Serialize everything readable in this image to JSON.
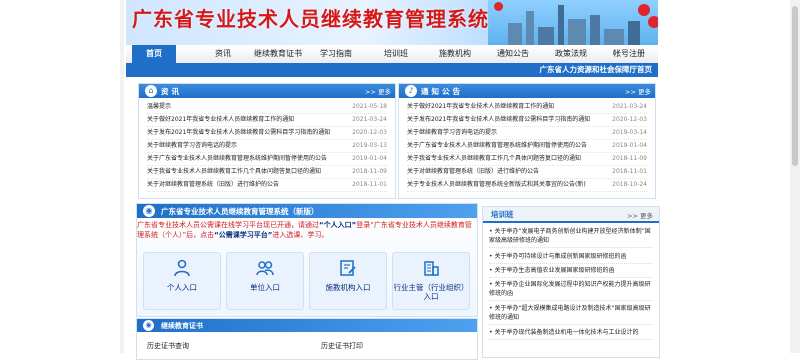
{
  "header": {
    "title": "广东省专业技术人员继续教育管理系统"
  },
  "nav": {
    "items": [
      {
        "label": "首页",
        "active": true
      },
      {
        "label": "资讯",
        "active": false
      },
      {
        "label": "继续教育证书",
        "active": false
      },
      {
        "label": "学习指南",
        "active": false
      },
      {
        "label": "培训班",
        "active": false
      },
      {
        "label": "施教机构",
        "active": false
      },
      {
        "label": "通知公告",
        "active": false
      },
      {
        "label": "政策法规",
        "active": false
      },
      {
        "label": "帐号注册",
        "active": false
      }
    ],
    "department": "广东省人力资源和社会保障厅首页"
  },
  "news_panel": {
    "title": "资讯",
    "more": "更多",
    "items": [
      {
        "title": "温馨提示",
        "date": "2021-05-18"
      },
      {
        "title": "关于做好2021年我省专业技术人员继续教育工作的通知",
        "date": "2021-03-24"
      },
      {
        "title": "关于发布2021年我省专业技术人员继续教育公需科目学习指南的通知",
        "date": "2020-12-03"
      },
      {
        "title": "关于继续教育学习咨询电话的提示",
        "date": "2019-03-13"
      },
      {
        "title": "关于广东省专业技术人员继续教育管理系统维护期间暂停使用的公告",
        "date": "2019-01-04"
      },
      {
        "title": "关于我省专业技术人员继续教育工作几个具体问题答复口径的通知",
        "date": "2018-11-09"
      },
      {
        "title": "关于对继续教育管理系统（旧版）进行维护的公告",
        "date": "2018-11-01"
      }
    ]
  },
  "notice_panel": {
    "title": "通知公告",
    "more": "更多",
    "items": [
      {
        "title": "关于做好2021年我省专业技术人员继续教育工作的通知",
        "date": "2021-03-24"
      },
      {
        "title": "关于发布2021年我省专业技术人员继续教育公需科目学习指南的通知",
        "date": "2020-12-03"
      },
      {
        "title": "关于继续教育学习咨询电话的提示",
        "date": "2019-03-14"
      },
      {
        "title": "关于广东省专业技术人员继续教育管理系统维护期间暂停使用的公告",
        "date": "2019-01-04"
      },
      {
        "title": "关于我省专业技术人员继续教育工作几个具体问题答复口径的通知",
        "date": "2018-11-09"
      },
      {
        "title": "关于对继续教育管理系统（旧版）进行维护的公告",
        "date": "2018-11-01"
      },
      {
        "title": "关于专业技术人员继续教育管理系统全新版式和其关事宜的公告(新)",
        "date": "2018-10-24"
      }
    ]
  },
  "entry_panel": {
    "title": "广东省专业技术人员继续教育管理系统（新版）",
    "notice_a": "广东省专业技术人员公需课在线学习平台现已开通，请通过",
    "notice_hl1": "“个人入口”",
    "notice_b": "登录“广东省专业技术人员继续教育管理系统（个人）”后，点击",
    "notice_hl2": "“公需课学习平台”",
    "notice_c": "进入选课、学习。",
    "tiles": [
      {
        "label": "个人入口",
        "icon": "person-icon"
      },
      {
        "label": "单位入口",
        "icon": "group-icon"
      },
      {
        "label": "施教机构入口",
        "icon": "edit-document-icon"
      },
      {
        "label": "行业主管（行业组织）入口",
        "icon": "building-icon"
      }
    ]
  },
  "cert_panel": {
    "title": "继续教育证书",
    "left_link": "历史证书查询",
    "right_link": "历史证书打印"
  },
  "training_panel": {
    "title": "培训班",
    "more": "更多",
    "items": [
      "关于举办“发展电子商务创新创业构建开放型经济新体制”国家级高级研修班的通知",
      "关于举办可持续设计与集成创新国家级研修班的函",
      "关于举办生态高值农业发展国家级研修班的函",
      "关于举办企业国际化发展过程中的知识产权能力提升高级研修班的函",
      "关于举办“超大规模集成电路设计及制造技术”国家级高级研修班的通知",
      "关于举办现代装备制造业机电一体化技术与工业设计的"
    ]
  },
  "colors": {
    "primary": "#1f6fc8",
    "title_red": "#d31a1a",
    "link_navy": "#0b2d7a"
  }
}
